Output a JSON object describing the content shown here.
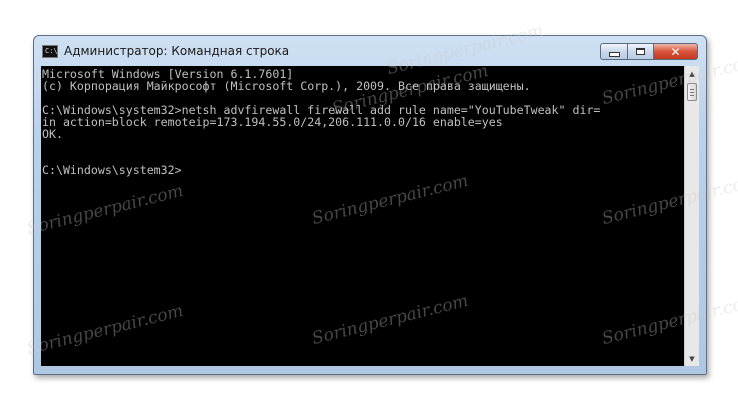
{
  "window": {
    "title": "Администратор: Командная строка",
    "icon_glyph": "C:\\"
  },
  "controls": {
    "minimize_icon": "minimize-icon",
    "maximize_icon": "maximize-icon",
    "close_glyph": "✕"
  },
  "console": {
    "lines": [
      "Microsoft Windows [Version 6.1.7601]",
      "(c) Корпорация Майкрософт (Microsoft Corp.), 2009. Все права защищены.",
      "",
      "C:\\Windows\\system32>netsh advfirewall firewall add rule name=\"YouTubeTweak\" dir=",
      "in action=block remoteip=173.194.55.0/24,206.111.0.0/16 enable=yes",
      "OK.",
      "",
      "",
      "C:\\Windows\\system32>"
    ]
  },
  "scrollbar": {
    "up_glyph": "▲",
    "down_glyph": "▼"
  },
  "watermark": "Soringperpair.com"
}
